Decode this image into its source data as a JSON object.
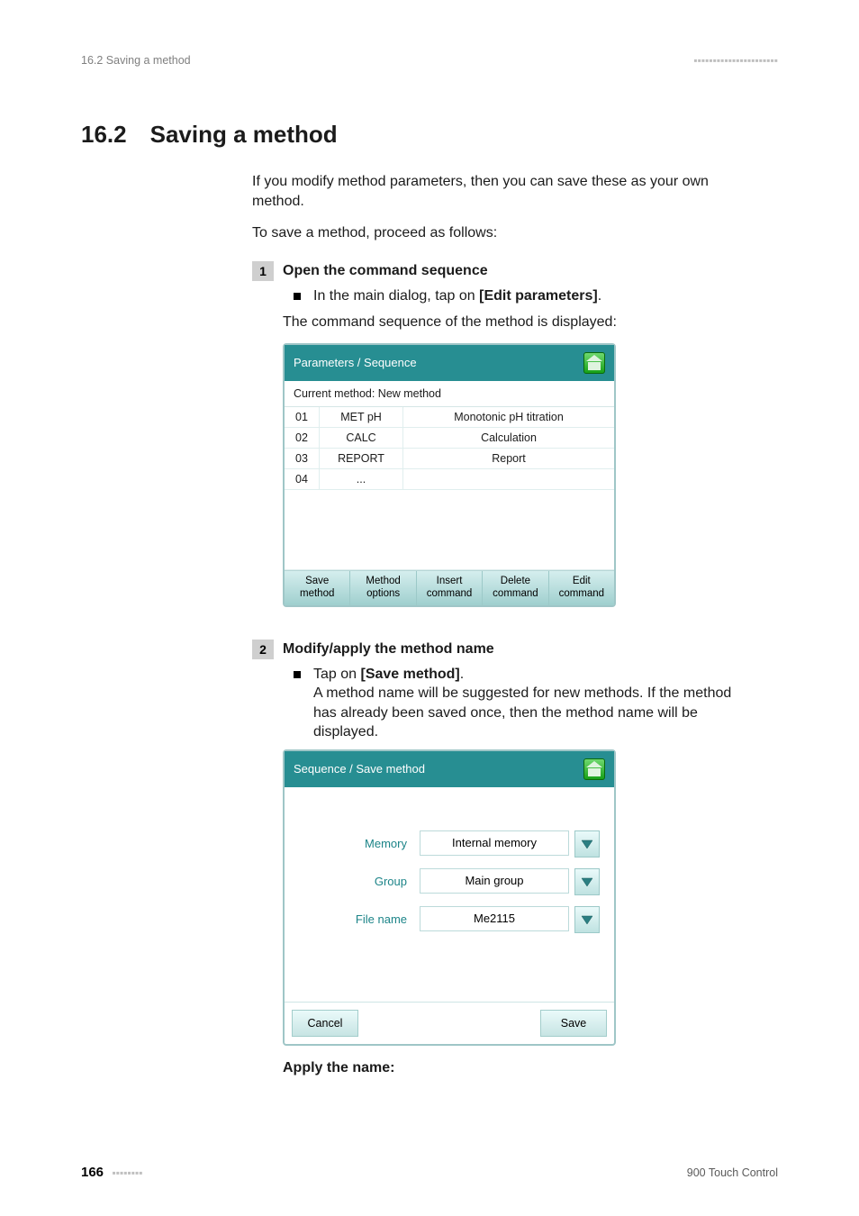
{
  "header": {
    "left": "16.2 Saving a method",
    "dashes": "▪▪▪▪▪▪▪▪▪▪▪▪▪▪▪▪▪▪▪▪▪▪"
  },
  "heading": {
    "number": "16.2",
    "title": "Saving a method"
  },
  "intro": {
    "p1": "If you modify method parameters, then you can save these as your own method.",
    "p2": "To save a method, proceed as follows:"
  },
  "step1": {
    "num": "1",
    "title": "Open the command sequence",
    "bullet_prefix": "In the main dialog, tap on ",
    "bullet_bold": "[Edit parameters]",
    "bullet_suffix": ".",
    "result": "The command sequence of the method is displayed:"
  },
  "seq_panel": {
    "title": "Parameters / Sequence",
    "subtitle": "Current method: New method",
    "rows": [
      {
        "idx": "01",
        "cmd": "MET pH",
        "desc": "Monotonic pH titration"
      },
      {
        "idx": "02",
        "cmd": "CALC",
        "desc": "Calculation"
      },
      {
        "idx": "03",
        "cmd": "REPORT",
        "desc": "Report"
      },
      {
        "idx": "04",
        "cmd": "...",
        "desc": ""
      }
    ],
    "toolbar": {
      "b1": "Save\nmethod",
      "b2": "Method\noptions",
      "b3": "Insert\ncommand",
      "b4": "Delete\ncommand",
      "b5": "Edit\ncommand"
    }
  },
  "step2": {
    "num": "2",
    "title": "Modify/apply the method name",
    "bullet_prefix": "Tap on ",
    "bullet_bold": "[Save method]",
    "bullet_suffix": ".",
    "desc": "A method name will be suggested for new methods. If the method has already been saved once, then the method name will be displayed."
  },
  "save_panel": {
    "title": "Sequence / Save method",
    "rows": {
      "memory": {
        "label": "Memory",
        "value": "Internal memory"
      },
      "group": {
        "label": "Group",
        "value": "Main group"
      },
      "filename": {
        "label": "File name",
        "value": "Me2115"
      }
    },
    "footer": {
      "cancel": "Cancel",
      "save": "Save"
    }
  },
  "apply_heading": "Apply the name:",
  "footer": {
    "page": "166",
    "dashes": "▪▪▪▪▪▪▪▪",
    "product": "900 Touch Control"
  }
}
